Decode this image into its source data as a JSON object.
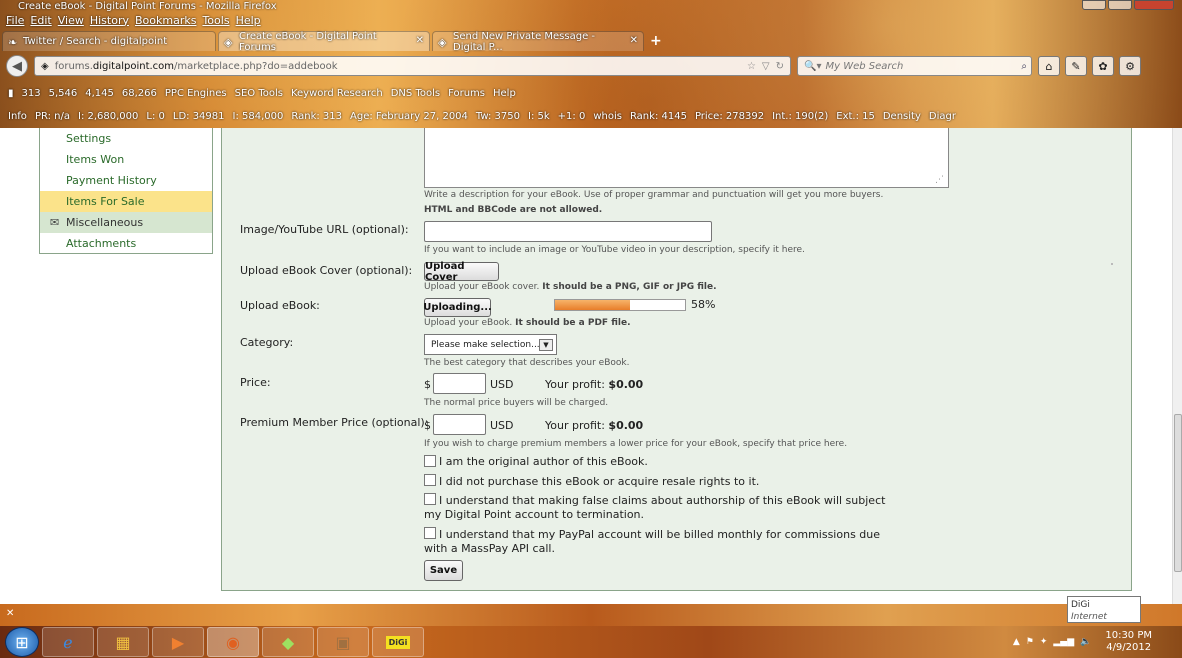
{
  "window": {
    "title": "Create eBook - Digital Point Forums - Mozilla Firefox"
  },
  "menu": [
    "File",
    "Edit",
    "View",
    "History",
    "Bookmarks",
    "Tools",
    "Help"
  ],
  "tabs": [
    {
      "label": "Twitter / Search - digitalpoint",
      "icon": "twitter-icon",
      "active": false
    },
    {
      "label": "Create eBook - Digital Point Forums",
      "icon": "digitalpoint-icon",
      "active": true
    },
    {
      "label": "Send New Private Message - Digital P...",
      "icon": "digitalpoint-icon",
      "active": false
    }
  ],
  "nav": {
    "url_prefix": "forums.",
    "url_domain": "digitalpoint.com",
    "url_path": "/marketplace.php?do=addebook",
    "search_placeholder": "My Web Search"
  },
  "seo_toolbar": {
    "row1": [
      "313",
      "5,546",
      "4,145",
      "68,266",
      "PPC Engines",
      "SEO Tools",
      "Keyword Research",
      "DNS Tools",
      "Forums",
      "Help"
    ],
    "row2": [
      "Info",
      "PR: n/a",
      "I: 2,680,000",
      "L: 0",
      "LD: 34981",
      "I: 584,000",
      "Rank: 313",
      "Age: February 27, 2004",
      "Tw: 3750",
      "I: 5k",
      "+1: 0",
      "whois",
      "Rank: 4145",
      "Price: 278392",
      "Int.: 190(2)",
      "Ext.: 15",
      "Density",
      "Diagr"
    ]
  },
  "sidebar": {
    "items": [
      {
        "label": "Settings"
      },
      {
        "label": "Items Won"
      },
      {
        "label": "Payment History"
      },
      {
        "label": "Items For Sale",
        "active": true
      },
      {
        "label": "Miscellaneous",
        "section": true
      },
      {
        "label": "Attachments"
      }
    ]
  },
  "form": {
    "description_hint": "Write a description for your eBook. Use of proper grammar and punctuation will get you more buyers.",
    "description_hint_bold": "HTML and BBCode are not allowed.",
    "image_label": "Image/YouTube URL (optional):",
    "image_value": "",
    "image_hint": "If you want to include an image or YouTube video in your description, specify it here.",
    "cover_label": "Upload eBook Cover (optional):",
    "cover_button": "Upload Cover",
    "cover_hint": "Upload your eBook cover.",
    "cover_hint_bold": "It should be a PNG, GIF or JPG file.",
    "ebook_label": "Upload eBook:",
    "ebook_button": "Uploading...",
    "ebook_progress": 0.58,
    "ebook_progress_text": "58%",
    "ebook_hint": "Upload your eBook.",
    "ebook_hint_bold": "It should be a PDF file.",
    "category_label": "Category:",
    "category_selected": "Please make selection...",
    "category_hint": "The best category that describes your eBook.",
    "price_label": "Price:",
    "currency_symbol": "$",
    "currency": "USD",
    "price_value": "",
    "profit_label": "Your profit:",
    "profit_value": "$0.00",
    "price_hint": "The normal price buyers will be charged.",
    "premium_label": "Premium Member Price (optional):",
    "premium_value": "",
    "premium_profit_value": "$0.00",
    "premium_hint": "If you wish to charge premium members a lower price for your eBook, specify that price here.",
    "checkboxes": [
      {
        "line1": "I am the original author of this eBook.",
        "line2": "",
        "checked": false
      },
      {
        "line1": "I did not purchase this eBook or acquire resale rights to it.",
        "line2": "",
        "checked": false
      },
      {
        "line1": "I understand that making false claims about authorship of this eBook will subject",
        "line2": "my Digital Point account to termination.",
        "checked": false
      },
      {
        "line1": "I understand that my PayPal account will be billed monthly for commissions due",
        "line2": "with a MassPay API call.",
        "checked": false
      }
    ],
    "save_button": "Save"
  },
  "taskbar": {
    "time": "10:30 PM",
    "date": "4/9/2012",
    "tooltip_title": "DiGi",
    "tooltip_text": "Internet access",
    "digi_label": "DiGi"
  }
}
